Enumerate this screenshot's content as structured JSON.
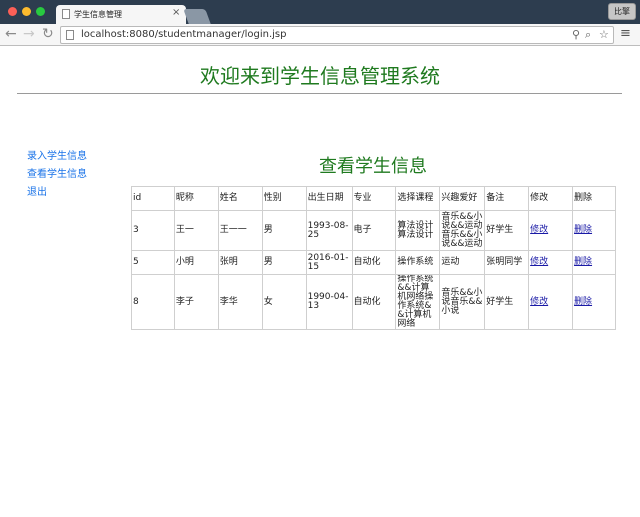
{
  "browser": {
    "tab_title": "学生信息管理",
    "tab_close": "×",
    "user_button": "比擎",
    "url": "localhost:8080/studentmanager/login.jsp",
    "nav": {
      "back": "←",
      "forward": "→",
      "reload": "↻"
    },
    "icons": {
      "key": "⚲",
      "zoom": "⌕",
      "star": "☆",
      "menu": "≡"
    }
  },
  "page": {
    "site_title": "欢迎来到学生信息管理系统",
    "section_title": "查看学生信息",
    "sidebar": [
      {
        "label": "录入学生信息"
      },
      {
        "label": "查看学生信息"
      },
      {
        "label": "退出"
      }
    ]
  },
  "table": {
    "headers": [
      "id",
      "昵称",
      "姓名",
      "性别",
      "出生日期",
      "专业",
      "选择课程",
      "兴趣爱好",
      "备注",
      "修改",
      "删除"
    ],
    "rows": [
      [
        "3",
        "王一",
        "王一一",
        "男",
        "1993-08-25",
        "电子",
        "算法设计算法设计",
        "音乐&&小说&&运动音乐&&小说&&运动",
        "好学生",
        "修改",
        "删除"
      ],
      [
        "5",
        "小明",
        "张明",
        "男",
        "2016-01-15",
        "自动化",
        "操作系统",
        "运动",
        "张明同学",
        "修改",
        "删除"
      ],
      [
        "8",
        "李子",
        "李华",
        "女",
        "1990-04-13",
        "自动化",
        "操作系统&&计算机网络操作系统&&计算机网络",
        "音乐&&小说音乐&&小说",
        "好学生",
        "修改",
        "删除"
      ]
    ]
  }
}
